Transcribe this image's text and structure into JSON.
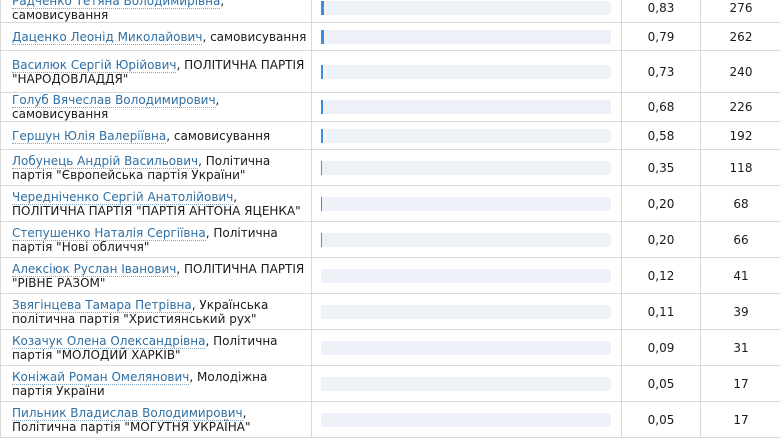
{
  "results": {
    "rows": [
      {
        "name": "Радченко Тетяна Володимирівна",
        "party": ", самовисування",
        "percent": "0,83",
        "votes": "276",
        "bar_fill_percent": 0.83
      },
      {
        "name": "Даценко Леонід Миколайович",
        "party": ", самовисування",
        "percent": "0,79",
        "votes": "262",
        "bar_fill_percent": 0.79
      },
      {
        "name": "Василюк Сергій Юрійович",
        "party": ", ПОЛІТИЧНА ПАРТІЯ \"НАРОДОВЛАДДЯ\"",
        "percent": "0,73",
        "votes": "240",
        "bar_fill_percent": 0.73
      },
      {
        "name": "Голуб Вячеслав Володимирович",
        "party": ", самовисування",
        "percent": "0,68",
        "votes": "226",
        "bar_fill_percent": 0.68
      },
      {
        "name": "Гершун Юлія Валеріївна",
        "party": ", самовисування",
        "percent": "0,58",
        "votes": "192",
        "bar_fill_percent": 0.58
      },
      {
        "name": "Лобунець Андрій Васильович",
        "party": ", Політична партія \"Європейська партія України\"",
        "percent": "0,35",
        "votes": "118",
        "bar_fill_percent": 0.35
      },
      {
        "name": "Чередніченко Сергій Анатолійович",
        "party": ", ПОЛІТИЧНА ПАРТІЯ \"ПАРТІЯ АНТОНА ЯЦЕНКА\"",
        "percent": "0,20",
        "votes": "68",
        "bar_fill_percent": 0.2
      },
      {
        "name": "Степушенко Наталія Сергіївна",
        "party": ", Політична партія \"Нові обличчя\"",
        "percent": "0,20",
        "votes": "66",
        "bar_fill_percent": 0.2
      },
      {
        "name": "Алексіюк Руслан Іванович",
        "party": ", ПОЛІТИЧНА ПАРТІЯ \"РІВНЕ РАЗОМ\"",
        "percent": "0,12",
        "votes": "41",
        "bar_fill_percent": 0.12
      },
      {
        "name": "Звягінцева Тамара Петрівна",
        "party": ", Українська політична партія \"Християнський рух\"",
        "percent": "0,11",
        "votes": "39",
        "bar_fill_percent": 0.11
      },
      {
        "name": "Козачук Олена Олександрівна",
        "party": ", Політична партія \"МОЛОДИЙ ХАРКІВ\"",
        "percent": "0,09",
        "votes": "31",
        "bar_fill_percent": 0.09
      },
      {
        "name": "Коніжай Роман Омелянович",
        "party": ", Молодіжна партія України",
        "percent": "0,05",
        "votes": "17",
        "bar_fill_percent": 0.05
      },
      {
        "name": "Пильник Владислав Володимирович",
        "party": ", Політична партія \"МОГУТНЯ УКРАЇНА\"",
        "percent": "0,05",
        "votes": "17",
        "bar_fill_percent": 0.05
      }
    ]
  },
  "colors": {
    "link": "#2f6fa3",
    "bar_fill": "#3a8de0",
    "bar_track": "#eef2f8",
    "grid_border": "#d9d9d9"
  }
}
